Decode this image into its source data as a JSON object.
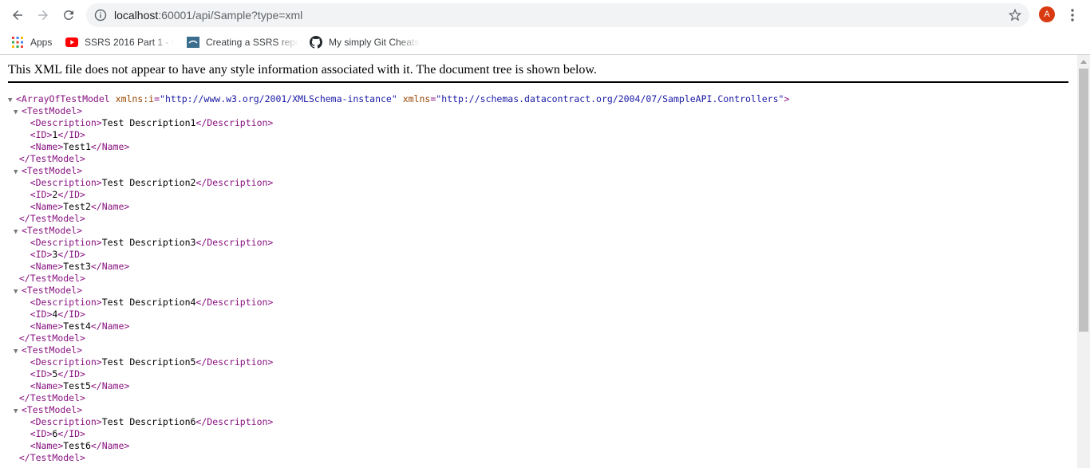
{
  "browser": {
    "url_host": "localhost",
    "url_rest": ":60001/api/Sample?type=xml",
    "avatar_letter": "A"
  },
  "bookmarks": [
    {
      "label": "Apps",
      "icon": "apps-grid-icon"
    },
    {
      "label": "SSRS 2016 Part 1 - Ci",
      "icon": "youtube-icon"
    },
    {
      "label": "Creating a SSRS repo",
      "icon": "bookmark-site-icon"
    },
    {
      "label": "My simply Git Cheats",
      "icon": "github-icon"
    }
  ],
  "notice": "This XML file does not appear to have any style information associated with it. The document tree is shown below.",
  "xml": {
    "root_open": "<ArrayOfTestModel",
    "attr1_name": "xmlns:i",
    "attr1_value": "\"http://www.w3.org/2001/XMLSchema-instance\"",
    "attr2_name": "xmlns",
    "attr2_value": "\"http://schemas.datacontract.org/2004/07/SampleAPI.Controllers\"",
    "root_close_bracket": ">",
    "models": [
      {
        "description": "Test Description1",
        "id": "1",
        "name": "Test1"
      },
      {
        "description": "Test Description2",
        "id": "2",
        "name": "Test2"
      },
      {
        "description": "Test Description3",
        "id": "3",
        "name": "Test3"
      },
      {
        "description": "Test Description4",
        "id": "4",
        "name": "Test4"
      },
      {
        "description": "Test Description5",
        "id": "5",
        "name": "Test5"
      },
      {
        "description": "Test Description6",
        "id": "6",
        "name": "Test6"
      }
    ]
  },
  "colors": {
    "tag": "#881280",
    "attribute": "#994500",
    "value": "#1a1aa6",
    "avatar": "#d93a12"
  }
}
